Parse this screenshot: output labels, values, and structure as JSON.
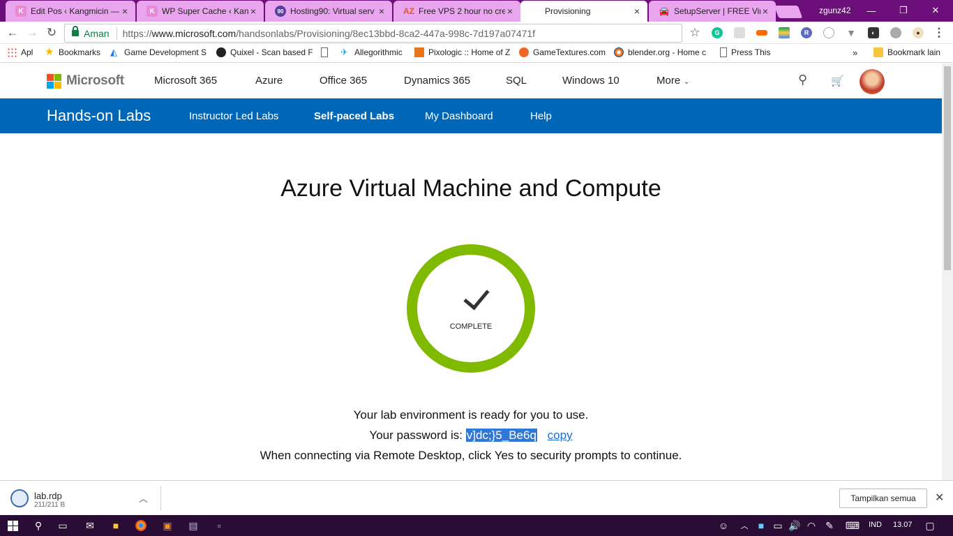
{
  "browser": {
    "tabs": [
      {
        "title": "Edit Pos ‹ Kangmicin —",
        "icon": "K",
        "icon_color": "#e88ad6"
      },
      {
        "title": "WP Super Cache ‹ Kang",
        "icon": "K",
        "icon_color": "#e88ad6"
      },
      {
        "title": "Hosting90: Virtual serv",
        "icon": "90",
        "icon_color": "#5b3fa0"
      },
      {
        "title": "Free VPS 2 hour no cre",
        "icon": "AZ",
        "icon_color": "#e05a1e"
      },
      {
        "title": "Provisioning",
        "icon": "ms",
        "icon_color": "#f25022"
      },
      {
        "title": "SetupServer | FREE Virt",
        "icon": "car",
        "icon_color": "#555555"
      }
    ],
    "active_tab": 4,
    "profile_name": "zgunz42",
    "secure_label": "Aman",
    "url_prefix": "https://",
    "url_domain": "www.microsoft.com",
    "url_path": "/handsonlabs/Provisioning/8ec13bbd-8ca2-447a-998c-7d197a07471f",
    "bookmarks": [
      {
        "label": "Apl",
        "icon": "apps-icon"
      },
      {
        "label": "Bookmarks",
        "icon": "star-icon"
      },
      {
        "label": "Game Development S",
        "icon": "unity-icon"
      },
      {
        "label": "Quixel - Scan based F",
        "icon": "quixel-icon"
      },
      {
        "label": "",
        "icon": "page-icon"
      },
      {
        "label": "Allegorithmic",
        "icon": "allegorithmic-icon"
      },
      {
        "label": "Pixologic :: Home of Z",
        "icon": "pixologic-icon"
      },
      {
        "label": "GameTextures.com",
        "icon": "gametextures-icon"
      },
      {
        "label": "blender.org - Home c",
        "icon": "blender-icon"
      },
      {
        "label": "Press This",
        "icon": "page-icon"
      }
    ],
    "bookmarks_more": "»",
    "other_bookmarks": "Bookmark lain"
  },
  "msheader": {
    "brand": "Microsoft",
    "nav": [
      "Microsoft 365",
      "Azure",
      "Office 365",
      "Dynamics 365",
      "SQL",
      "Windows 10",
      "More"
    ]
  },
  "labs": {
    "title": "Hands-on Labs",
    "nav": [
      "Instructor Led Labs",
      "Self-paced Labs",
      "My Dashboard",
      "Help"
    ],
    "active_nav": "Self-paced Labs"
  },
  "main": {
    "heading": "Azure Virtual Machine and Compute",
    "status": "COMPLETE",
    "ready_text": "Your lab environment is ready for you to use.",
    "password_label": "Your password is:",
    "password": "v]dc;}5_Be6q",
    "copy_label": "copy",
    "rdp_text": "When connecting via Remote Desktop, click Yes to security prompts to continue."
  },
  "downloads": {
    "file": "lab.rdp",
    "size": "211/211 B",
    "show_all": "Tampilkan semua"
  },
  "taskbar": {
    "language": "IND",
    "time": "13.07"
  },
  "colors": {
    "tabbar": "#6d0f7a",
    "labs_bar": "#0067b8",
    "ring": "#7fba00",
    "selection": "#3178d6"
  }
}
